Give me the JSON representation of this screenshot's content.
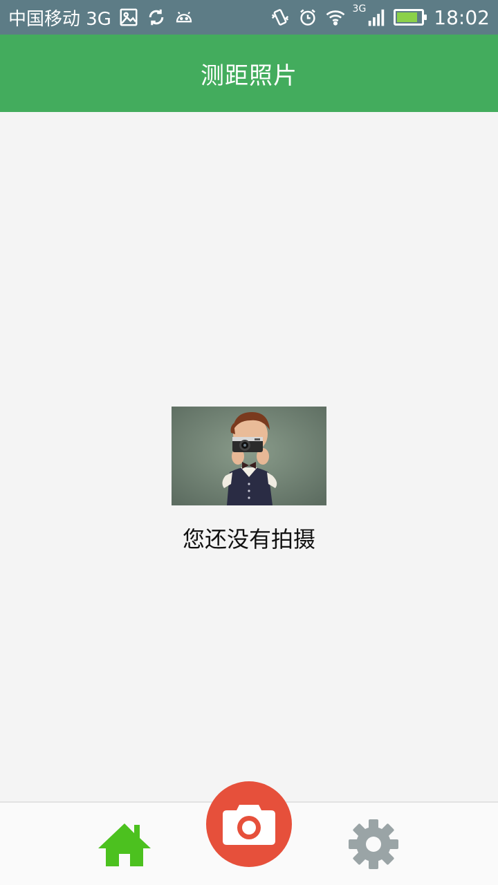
{
  "status_bar": {
    "carrier": "中国移动 3G",
    "network_small": "3G",
    "time": "18:02",
    "battery_level": 0.85,
    "icons": [
      "image-icon",
      "sync-icon",
      "android-icon",
      "vibrate-icon",
      "alarm-icon",
      "wifi-icon",
      "signal-icon",
      "battery-icon"
    ]
  },
  "app_bar": {
    "title": "测距照片"
  },
  "empty_state": {
    "message": "您还没有拍摄",
    "illustration": "child-with-camera-photo"
  },
  "bottom_nav": {
    "items": [
      {
        "icon": "home-icon"
      },
      {
        "icon": "camera-icon"
      },
      {
        "icon": "gear-icon"
      }
    ]
  },
  "colors": {
    "status_bar": "#5d7c86",
    "app_bar": "#43ac5d",
    "background": "#f4f4f4",
    "home_icon": "#4cc11f",
    "camera_button": "#e6503b",
    "settings_icon": "#9aa4a6"
  }
}
